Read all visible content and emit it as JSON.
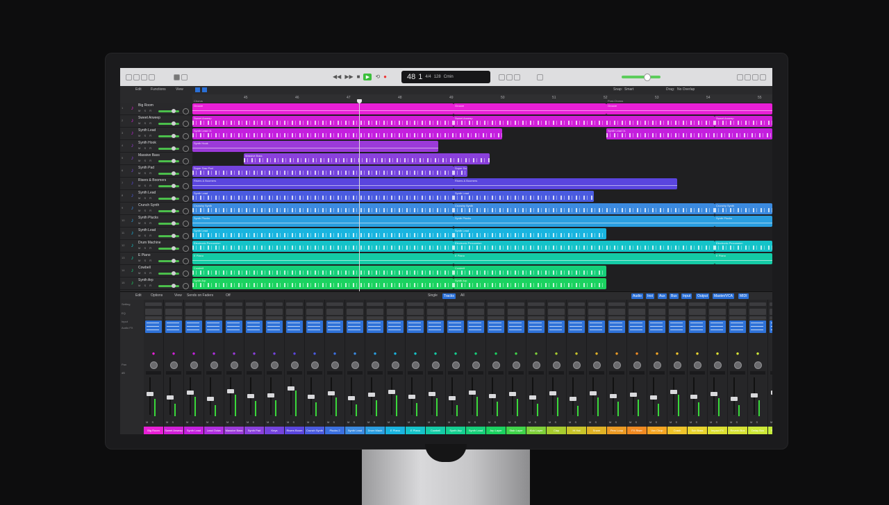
{
  "transport": {
    "rewind_icon": "rewind-icon",
    "forward_icon": "fast-forward-icon",
    "stop_icon": "stop-icon",
    "play_icon": "play-icon",
    "record_icon": "record-icon",
    "play_glyph": "▶",
    "rewind_glyph": "◀◀",
    "forward_glyph": "▶▶",
    "stop_glyph": "■",
    "record_glyph": "●",
    "cycle_glyph": "⟲"
  },
  "lcd": {
    "bar": "48",
    "beat": "1",
    "time_sig": "4/4",
    "tempo": "128",
    "key": "Cmin"
  },
  "track_toolbar": {
    "edit": "Edit",
    "functions": "Functions",
    "view": "View",
    "snap_label": "Snap:",
    "snap_value": "Smart",
    "drag_label": "Drag:",
    "drag_value": "No Overlap"
  },
  "ruler": {
    "bars": [
      "45",
      "46",
      "47",
      "48",
      "49",
      "50",
      "51",
      "52",
      "53",
      "54",
      "55",
      "56"
    ],
    "marker_left": "Chorus",
    "marker_right": "Post-Chorus"
  },
  "tracks": [
    {
      "n": "1",
      "name": "Big Room",
      "color": "#e81fd6"
    },
    {
      "n": "2",
      "name": "Sweet Arweep",
      "color": "#d11fd8"
    },
    {
      "n": "3",
      "name": "Synth Lead",
      "color": "#c41fde"
    },
    {
      "n": "4",
      "name": "Synth Hook",
      "color": "#9b3ad9"
    },
    {
      "n": "5",
      "name": "Massive Bass",
      "color": "#8a40dc"
    },
    {
      "n": "6",
      "name": "Synth Pad",
      "color": "#7443dd"
    },
    {
      "n": "7",
      "name": "Risers & Boomers",
      "color": "#5a45de"
    },
    {
      "n": "8",
      "name": "Synth Lead",
      "color": "#4a5be0"
    },
    {
      "n": "9",
      "name": "Crunch Synth",
      "color": "#3b8ae0"
    },
    {
      "n": "10",
      "name": "Synth Plucks",
      "color": "#2a9ee0"
    },
    {
      "n": "11",
      "name": "Synth Lead",
      "color": "#19b4df"
    },
    {
      "n": "12",
      "name": "Drum Machine",
      "color": "#15c3c9"
    },
    {
      "n": "13",
      "name": "E Piano",
      "color": "#14cba6"
    },
    {
      "n": "14",
      "name": "Cowbell",
      "color": "#16cf79"
    },
    {
      "n": "15",
      "name": "Synth Arp",
      "color": "#1bd260"
    }
  ],
  "regions": [
    {
      "row": 0,
      "label": "Groove",
      "color": "#e81fd6"
    },
    {
      "row": 0,
      "label": "Groove",
      "color": "#e81fd6"
    },
    {
      "row": 0,
      "label": "Groove",
      "color": "#e81fd6"
    },
    {
      "row": 1,
      "label": "Sweet Arweep",
      "color": "#d11fd8"
    },
    {
      "row": 1,
      "label": "Sweet Arweep",
      "color": "#d11fd8"
    },
    {
      "row": 1,
      "label": "Sweet Arweep",
      "color": "#d11fd8"
    },
    {
      "row": 2,
      "label": "Synth Lead 01",
      "color": "#c41fde"
    },
    {
      "row": 2,
      "label": "Synth Lead 01",
      "color": "#c41fde"
    },
    {
      "row": 2,
      "label": "Synth Lead 01",
      "color": "#c41fde"
    },
    {
      "row": 3,
      "label": "Synth Hook",
      "color": "#9b3ad9"
    },
    {
      "row": 4,
      "label": "Massive Bass",
      "color": "#8a40dc"
    },
    {
      "row": 5,
      "label": "Super Saw Pad",
      "color": "#7443dd"
    },
    {
      "row": 5,
      "label": "Super Sa",
      "color": "#7443dd"
    },
    {
      "row": 6,
      "label": "Risers & Boomers",
      "color": "#5a45de"
    },
    {
      "row": 6,
      "label": "Risers & Boomers",
      "color": "#5a45de"
    },
    {
      "row": 7,
      "label": "Synth Lead",
      "color": "#4a5be0"
    },
    {
      "row": 7,
      "label": "Synth Lead",
      "color": "#4a5be0"
    },
    {
      "row": 8,
      "label": "Crunchy Synth",
      "color": "#3b8ae0"
    },
    {
      "row": 8,
      "label": "Crunchy Synth",
      "color": "#3b8ae0"
    },
    {
      "row": 8,
      "label": "Crunchy Synth",
      "color": "#3b8ae0"
    },
    {
      "row": 9,
      "label": "Synth Plucks",
      "color": "#2a9ee0"
    },
    {
      "row": 9,
      "label": "Synth Plucks",
      "color": "#2a9ee0"
    },
    {
      "row": 9,
      "label": "Synth Plucks",
      "color": "#2a9ee0"
    },
    {
      "row": 10,
      "label": "Synth Lead",
      "color": "#19b4df"
    },
    {
      "row": 10,
      "label": "Synth Lead",
      "color": "#19b4df"
    },
    {
      "row": 11,
      "label": "Electronic Percussion",
      "color": "#15c3c9"
    },
    {
      "row": 11,
      "label": "Electronic Percussion",
      "color": "#15c3c9"
    },
    {
      "row": 11,
      "label": "Electronic Percussion",
      "color": "#15c3c9"
    },
    {
      "row": 12,
      "label": "E Piano",
      "color": "#14cba6"
    },
    {
      "row": 12,
      "label": "E Piano",
      "color": "#14cba6"
    },
    {
      "row": 12,
      "label": "E Piano",
      "color": "#14cba6"
    },
    {
      "row": 13,
      "label": "Cowbell",
      "color": "#16cf79"
    },
    {
      "row": 13,
      "label": "Cowbell",
      "color": "#16cf79"
    },
    {
      "row": 14,
      "label": "Synth Arp",
      "color": "#1bd260"
    },
    {
      "row": 14,
      "label": "Synth Arp",
      "color": "#1bd260"
    }
  ],
  "mixer_toolbar": {
    "edit": "Edit",
    "options": "Options",
    "view": "View",
    "sends": "Sends on Faders",
    "sends_value": "Off",
    "single": "Single",
    "tracks": "Tracks",
    "all": "All",
    "filters": [
      "Audio",
      "Inst",
      "Aux",
      "Bus",
      "Input",
      "Output",
      "Master/VCA",
      "MIDI"
    ]
  },
  "mixer_labels": {
    "setting": "Setting",
    "eq": "EQ",
    "input": "Input",
    "audio_fx": "Audio FX",
    "pan": "Pan",
    "db": "dB"
  },
  "strips": [
    {
      "name": "Big Room",
      "color": "#e81fd6",
      "level": 0.55
    },
    {
      "name": "Sweet Arweep",
      "color": "#d11fd8",
      "level": 0.4
    },
    {
      "name": "Synth Lead",
      "color": "#c41fde",
      "level": 0.62
    },
    {
      "name": "Lead Octav",
      "color": "#b02ee0",
      "level": 0.35
    },
    {
      "name": "Massive Bass",
      "color": "#9b3ad9",
      "level": 0.7
    },
    {
      "name": "Synth Pad",
      "color": "#8a40dc",
      "level": 0.48
    },
    {
      "name": "Keys",
      "color": "#7443dd",
      "level": 0.5
    },
    {
      "name": "Risers Boom",
      "color": "#5a45de",
      "level": 0.82
    },
    {
      "name": "Crunch Synth",
      "color": "#4a5be0",
      "level": 0.44
    },
    {
      "name": "Plucks 2",
      "color": "#3b70e0",
      "level": 0.6
    },
    {
      "name": "Synth Lead",
      "color": "#3b8ae0",
      "level": 0.38
    },
    {
      "name": "Drum Mach",
      "color": "#2a9ee0",
      "level": 0.52
    },
    {
      "name": "E Piano",
      "color": "#19b4df",
      "level": 0.66
    },
    {
      "name": "E Piano",
      "color": "#15c3c9",
      "level": 0.42
    },
    {
      "name": "Cowbell",
      "color": "#14cba6",
      "level": 0.58
    },
    {
      "name": "Synth Arp",
      "color": "#14cf90",
      "level": 0.36
    },
    {
      "name": "Synth Lead",
      "color": "#16cf79",
      "level": 0.63
    },
    {
      "name": "Arp Layer",
      "color": "#1bd260",
      "level": 0.47
    },
    {
      "name": "Stab Layer",
      "color": "#40d44a",
      "level": 0.55
    },
    {
      "name": "Kick Layer",
      "color": "#7fd03a",
      "level": 0.41
    },
    {
      "name": "Clap",
      "color": "#a8cc2f",
      "level": 0.59
    },
    {
      "name": "Hi Hat",
      "color": "#c9c42a",
      "level": 0.33
    },
    {
      "name": "Snare",
      "color": "#e0b226",
      "level": 0.61
    },
    {
      "name": "Perc Loop",
      "color": "#eb9a24",
      "level": 0.46
    },
    {
      "name": "FX Riser",
      "color": "#f08a22",
      "level": 0.54
    },
    {
      "name": "Vox Chop",
      "color": "#f5a623",
      "level": 0.39
    },
    {
      "name": "Crash",
      "color": "#efc42b",
      "level": 0.68
    },
    {
      "name": "Sub Bass",
      "color": "#e8d42f",
      "level": 0.44
    },
    {
      "name": "Impact FX",
      "color": "#dce032",
      "level": 0.57
    },
    {
      "name": "Reverb Bus",
      "color": "#d6e235",
      "level": 0.35
    },
    {
      "name": "Delay Bus",
      "color": "#cde838",
      "level": 0.5
    },
    {
      "name": "Stereo Out",
      "color": "#c5ec3a",
      "level": 0.63
    }
  ]
}
